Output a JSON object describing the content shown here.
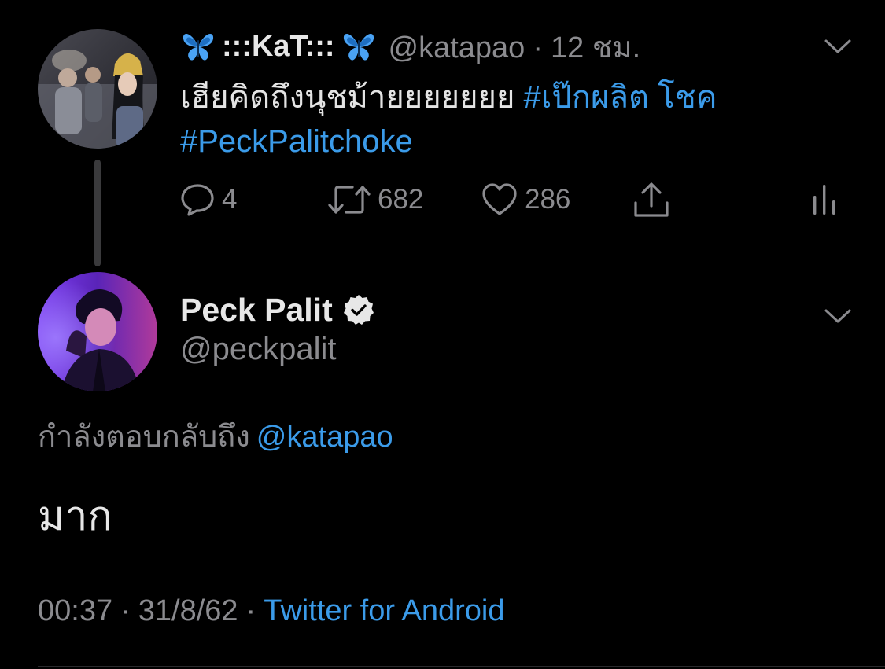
{
  "parent_tweet": {
    "display_name": ":::KaT:::",
    "name_decoration_icon": "butterfly-emoji",
    "handle": "@katapao",
    "separator": "·",
    "time_ago": "12 ชม.",
    "text": "เฮียคิดถึงนุชม้ายยยยยยย",
    "hashtags": [
      "#เป๊กผลิต โชค",
      "#PeckPalitchoke"
    ],
    "actions": {
      "reply_icon": "comment-icon",
      "reply_count": "4",
      "retweet_icon": "retweet-icon",
      "retweet_count": "682",
      "like_icon": "heart-icon",
      "like_count": "286",
      "share_icon": "share-icon",
      "analytics_icon": "analytics-icon"
    }
  },
  "reply_tweet": {
    "display_name": "Peck Palit",
    "verified_icon": "verified-badge-icon",
    "handle": "@peckpalit",
    "replying_to_label": "กำลังตอบกลับถึง",
    "replying_to_handle": "@katapao",
    "text": "มาก",
    "time": "00:37",
    "separator": "·",
    "date": "31/8/62",
    "source": "Twitter for Android"
  },
  "colors": {
    "background": "#000000",
    "primary_text": "#e7e7e7",
    "secondary_text": "#8b8b8f",
    "link": "#3b9be9",
    "thread_line": "#3a3a3c"
  }
}
